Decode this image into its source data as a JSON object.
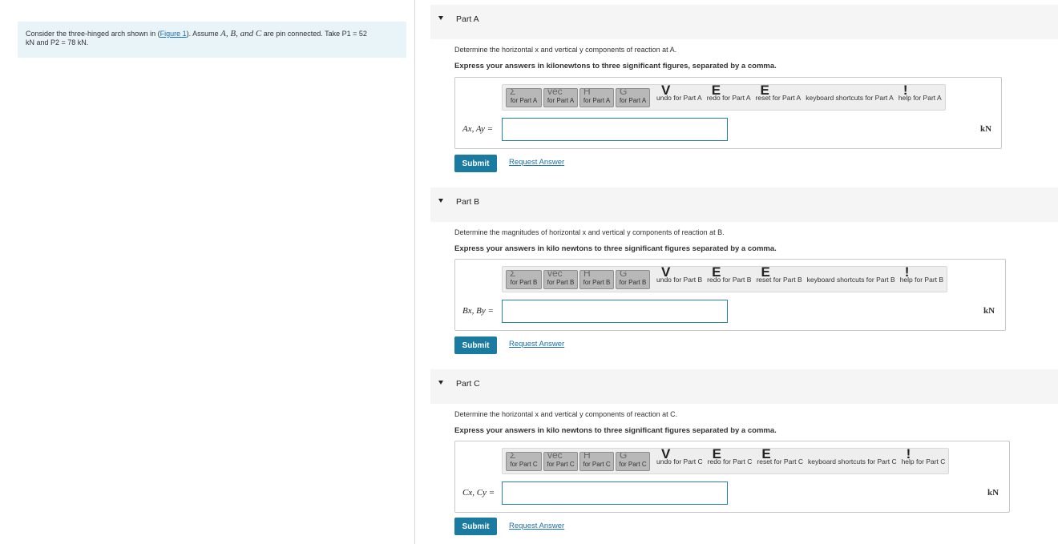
{
  "intro": {
    "text_before": "Consider the three-hinged arch shown in (",
    "figure_link": "Figure 1",
    "text_after": "). Assume ",
    "pins": "A, B, and C",
    "text_pin": " are pin connected. Take ",
    "p1": "P1 = 52",
    "line2": "kN and P2 = 78 kN."
  },
  "parts": [
    {
      "title": "Part A",
      "question": "Determine the horizontal x and vertical y components of reaction at A.",
      "instruction": "Express your answers in kilonewtons to three significant figures, separated by a comma.",
      "toolbar": {
        "btn1": "for Part A",
        "btn2": "for Part A",
        "btn3": "for Part A",
        "btn4": "for Part A",
        "undo": "undo for Part A",
        "redo": "redo for Part A",
        "reset": "reset for Part A",
        "shortcuts": "keyboard shortcuts for Part A",
        "help": "help for Part A"
      },
      "label": "Ax, Ay =",
      "input_value": "",
      "unit": "kN",
      "submit": "Submit",
      "request": "Request Answer"
    },
    {
      "title": "Part B",
      "question": "Determine the magnitudes of horizontal x and vertical y components of reaction at B.",
      "instruction": "Express your answers in kilo newtons to three significant figures separated by a comma.",
      "toolbar": {
        "btn1": "for Part B",
        "btn2": "for Part B",
        "btn3": "for Part B",
        "btn4": "for Part B",
        "undo": "undo for Part B",
        "redo": "redo for Part B",
        "reset": "reset for Part B",
        "shortcuts": "keyboard shortcuts for Part B",
        "help": "help for Part B"
      },
      "label": "Bx, By =",
      "input_value": "",
      "unit": "kN",
      "submit": "Submit",
      "request": "Request Answer"
    },
    {
      "title": "Part C",
      "question": "Determine the horizontal x and vertical y components of reaction at C.",
      "instruction": "Express your answers in kilo newtons to three significant figures separated by a comma.",
      "toolbar": {
        "btn1": "for Part C",
        "btn2": "for Part C",
        "btn3": "for Part C",
        "btn4": "for Part C",
        "undo": "undo for Part C",
        "redo": "redo for Part C",
        "reset": "reset for Part C",
        "shortcuts": "keyboard shortcuts for Part C",
        "help": "help for Part C"
      },
      "label": "Cx, Cy =",
      "input_value": "",
      "unit": "kN",
      "submit": "Submit",
      "request": "Request Answer"
    }
  ]
}
